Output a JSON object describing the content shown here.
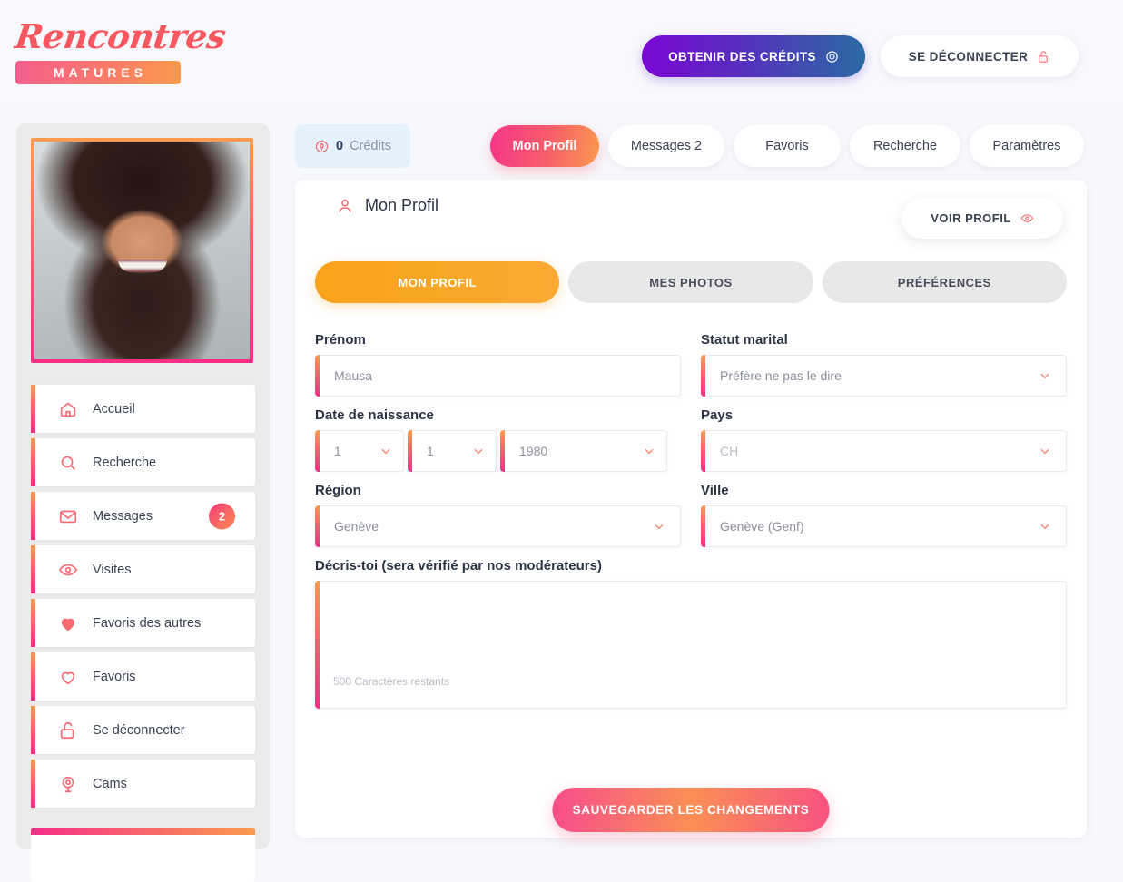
{
  "brand": {
    "script": "Rencontres",
    "bar": "MATURES"
  },
  "header": {
    "credits_button": "OBTENIR DES CRÉDITS",
    "credits_icon": "target-icon",
    "logout_button": "SE DÉCONNECTER",
    "logout_icon": "lock-open-icon"
  },
  "credits": {
    "count": "0",
    "label": "Crédits",
    "icon": "credit-token-icon"
  },
  "tabs": [
    {
      "label": "Mon Profil",
      "active": true
    },
    {
      "label": "Messages 2",
      "active": false
    },
    {
      "label": "Favoris",
      "active": false
    },
    {
      "label": "Recherche",
      "active": false
    },
    {
      "label": "Paramètres",
      "active": false
    }
  ],
  "sidebar": {
    "avatar_alt": "profile-photo",
    "items": [
      {
        "label": "Accueil",
        "icon": "home-icon",
        "badge": ""
      },
      {
        "label": "Recherche",
        "icon": "search-icon",
        "badge": ""
      },
      {
        "label": "Messages",
        "icon": "mail-icon",
        "badge": "2"
      },
      {
        "label": "Visites",
        "icon": "eye-icon",
        "badge": ""
      },
      {
        "label": "Favoris des autres",
        "icon": "heart-filled-icon",
        "badge": ""
      },
      {
        "label": "Favoris",
        "icon": "heart-outline-icon",
        "badge": ""
      },
      {
        "label": "Se déconnecter",
        "icon": "lock-open-icon",
        "badge": ""
      },
      {
        "label": "Cams",
        "icon": "webcam-icon",
        "badge": ""
      }
    ]
  },
  "panel": {
    "title": "Mon Profil",
    "title_icon": "user-icon",
    "view_profile_button": "VOIR PROFIL",
    "view_profile_icon": "eye-icon",
    "subtabs": [
      {
        "label": "MON PROFIL",
        "active": true
      },
      {
        "label": "MES PHOTOS",
        "active": false
      },
      {
        "label": "PRÉFÉRENCES",
        "active": false
      }
    ]
  },
  "form": {
    "firstname": {
      "label": "Prénom",
      "value": "Mausa",
      "placeholder": "Prénom"
    },
    "marital": {
      "label": "Statut marital",
      "value": "Préfère ne pas le dire"
    },
    "dob": {
      "label": "Date de naissance",
      "day": "1",
      "month": "1",
      "year": "1980"
    },
    "country": {
      "label": "Pays",
      "value": "CH"
    },
    "region": {
      "label": "Région",
      "value": "Genève"
    },
    "city": {
      "label": "Ville",
      "value": "Genève (Genf)"
    },
    "about": {
      "label": "Décris-toi (sera vérifié par nos modérateurs)",
      "value": "",
      "counter": "500 Caractères restants"
    },
    "save_button": "SAUVEGARDER LES CHANGEMENTS"
  },
  "colors": {
    "pink": "#f62d86",
    "coral": "#f7606f",
    "orange": "#fa9a4e",
    "amber": "#f9a21b",
    "purple": "#7b07d4",
    "teal": "#2a6ba3",
    "page_bg": "#f7f8fc",
    "sidebar_bg": "#ecebe9",
    "credits_bg": "#e4f1fb"
  }
}
